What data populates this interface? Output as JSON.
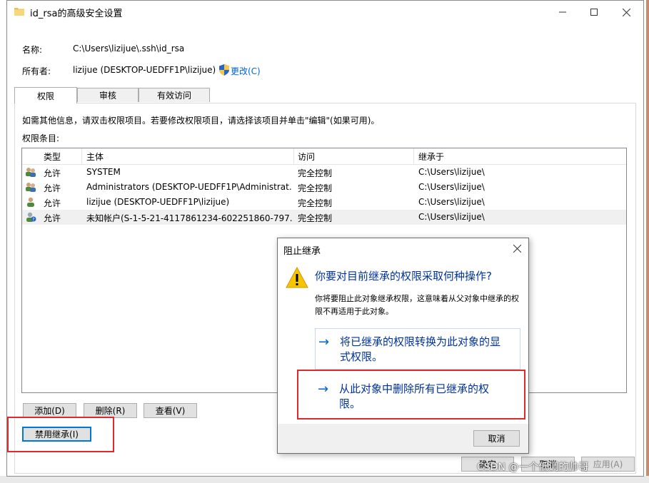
{
  "window": {
    "title": "id_rsa的高级安全设置",
    "controls": [
      "minimize",
      "maximize",
      "close"
    ]
  },
  "info": {
    "name_label": "名称:",
    "name_value": "C:\\Users\\lizijue\\.ssh\\id_rsa",
    "owner_label": "所有者:",
    "owner_value": "lizijue (DESKTOP-UEDFF1P\\lizijue)",
    "change_link": "更改(C)"
  },
  "tabs": [
    "权限",
    "审核",
    "有效访问"
  ],
  "panel": {
    "hint": "如需其他信息，请双击权限项目。若要修改权限项目，请选择该项目并单击\"编辑\"(如果可用)。",
    "entries_label": "权限条目:",
    "columns": [
      "类型",
      "主体",
      "访问",
      "继承于"
    ],
    "rows": [
      {
        "icon": "group-users-icon",
        "type": "允许",
        "principal": "SYSTEM",
        "access": "完全控制",
        "inherited": "C:\\Users\\lizijue\\"
      },
      {
        "icon": "group-users-icon",
        "type": "允许",
        "principal": "Administrators (DESKTOP-UEDFF1P\\Administrat...",
        "access": "完全控制",
        "inherited": "C:\\Users\\lizijue\\"
      },
      {
        "icon": "user-icon",
        "type": "允许",
        "principal": "lizijue (DESKTOP-UEDFF1P\\lizijue)",
        "access": "完全控制",
        "inherited": "C:\\Users\\lizijue\\"
      },
      {
        "icon": "unknown-user-icon",
        "type": "允许",
        "principal": "未知帐户(S-1-5-21-4117861234-602251860-797...",
        "access": "完全控制",
        "inherited": "C:\\Users\\lizijue\\"
      }
    ],
    "buttons": {
      "add": "添加(D)",
      "delete": "删除(R)",
      "view": "查看(V)"
    },
    "disable_inheritance": "禁用继承(I)"
  },
  "footer": {
    "ok": "确定",
    "cancel": "取消",
    "apply": "应用(A)"
  },
  "dialog": {
    "title": "阻止继承",
    "question": "你要对目前继承的权限采取何种操作?",
    "description": "你将要阻止此对象继承权限，这意味着从父对象中继承的权限不再适用于此对象。",
    "option1_line1": "将已继承的权限转换为此对象的显",
    "option1_line2": "式权限。",
    "option2_line1": "从此对象中删除所有已继承的权",
    "option2_line2": "限。",
    "cancel": "取消"
  },
  "watermark": "CSDN @一个低调的帅哥",
  "colors": {
    "accent": "#0078d7",
    "highlight_box": "#e0292f",
    "link": "#0066cc",
    "cmdlink": "#003399"
  }
}
